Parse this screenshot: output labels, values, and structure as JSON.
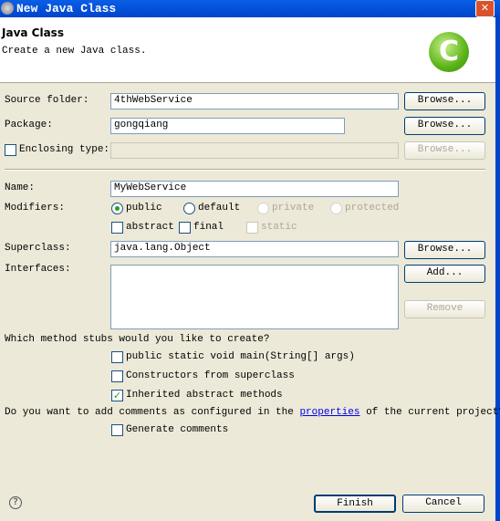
{
  "window": {
    "title": "New Java Class",
    "close_icon": "close-icon"
  },
  "header": {
    "title": "Java Class",
    "description": "Create a new Java class.",
    "logo_letter": "C"
  },
  "form": {
    "source_folder": {
      "label": "Source folder:",
      "value": "4thWebService",
      "browse": "Browse..."
    },
    "package": {
      "label": "Package:",
      "value": "gongqiang",
      "browse": "Browse..."
    },
    "enclosing": {
      "label": "Enclosing type:",
      "value": "",
      "browse": "Browse...",
      "checked": false
    },
    "name": {
      "label": "Name:",
      "value": "MyWebService"
    },
    "modifiers": {
      "label": "Modifiers:",
      "public": "public",
      "default": "default",
      "private": "private",
      "protected": "protected",
      "abstract": "abstract",
      "final": "final",
      "static": "static",
      "selected": "public"
    },
    "superclass": {
      "label": "Superclass:",
      "value": "java.lang.Object",
      "browse": "Browse..."
    },
    "interfaces": {
      "label": "Interfaces:",
      "add": "Add...",
      "remove": "Remove"
    },
    "stubs": {
      "question": "Which method stubs would you like to create?",
      "main": "public static void main(String[] args)",
      "constructors": "Constructors from superclass",
      "inherited": "Inherited abstract methods"
    },
    "comments": {
      "question_pre": "Do you want to add comments as configured in the ",
      "link": "properties",
      "question_post": " of the current project?",
      "generate": "Generate comments"
    }
  },
  "footer": {
    "finish": "Finish",
    "cancel": "Cancel",
    "help": "?"
  }
}
